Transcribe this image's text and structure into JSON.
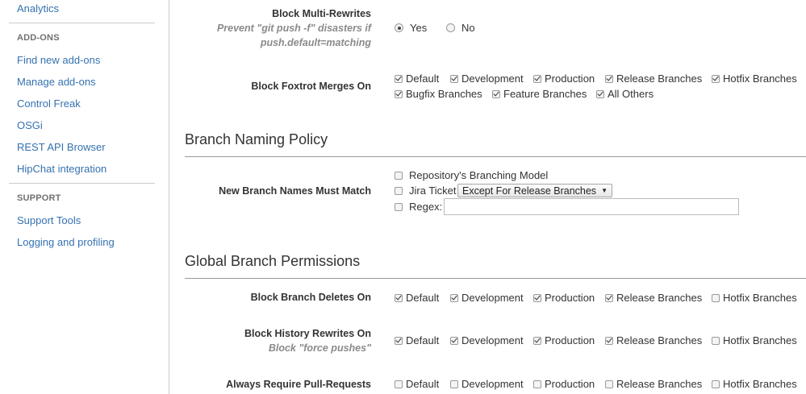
{
  "sidebar": {
    "analytics": "Analytics",
    "addons_heading": "ADD-ONS",
    "addons": [
      "Find new add-ons",
      "Manage add-ons",
      "Control Freak",
      "OSGi",
      "REST API Browser",
      "HipChat integration"
    ],
    "support_heading": "SUPPORT",
    "support": [
      "Support Tools",
      "Logging and profiling"
    ]
  },
  "multi_rewrites": {
    "label": "Block Multi-Rewrites",
    "sub1": "Prevent \"git push -f\" disasters if",
    "sub2": "push.default=matching",
    "yes": "Yes",
    "no": "No"
  },
  "foxtrot": {
    "label": "Block Foxtrot Merges On",
    "opts": [
      "Default",
      "Development",
      "Production",
      "Release Branches",
      "Hotfix Branches",
      "Bugfix Branches",
      "Feature Branches",
      "All Others"
    ]
  },
  "naming": {
    "title": "Branch Naming Policy",
    "label": "New Branch Names Must Match",
    "repo_model": "Repository's Branching Model",
    "jira": "Jira Ticket",
    "jira_select": "Except For Release Branches",
    "regex": "Regex:",
    "regex_value": ""
  },
  "perms": {
    "title": "Global Branch Permissions",
    "deletes_label": "Block Branch Deletes On",
    "rewrites_label": "Block History Rewrites On",
    "rewrites_sub": "Block \"force pushes\"",
    "pr_label": "Always Require Pull-Requests",
    "opts": [
      "Default",
      "Development",
      "Production",
      "Release Branches",
      "Hotfix Branches"
    ]
  }
}
